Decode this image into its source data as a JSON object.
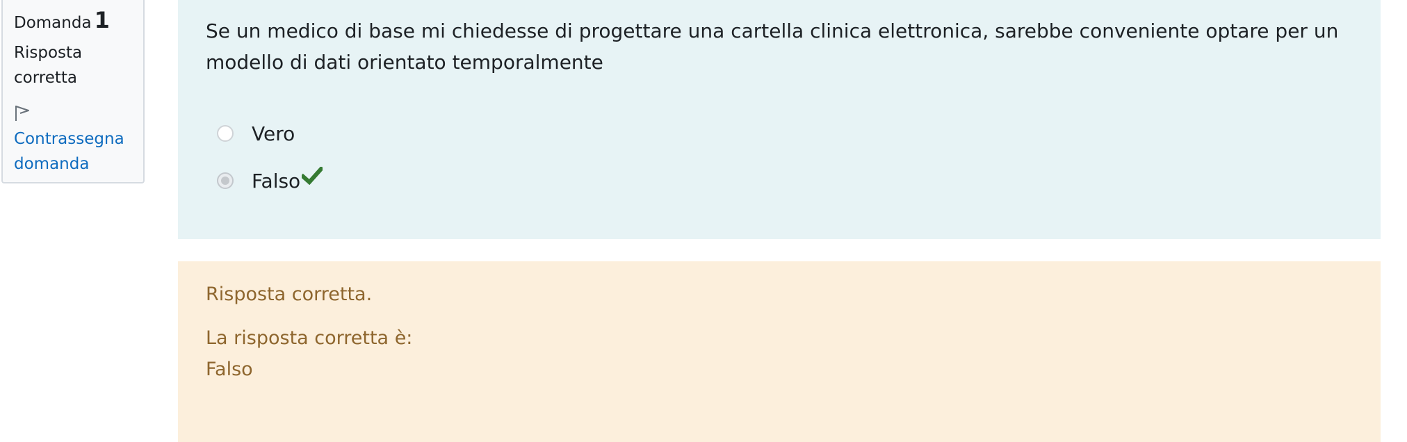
{
  "question_info": {
    "label": "Domanda",
    "number": "1",
    "state": "Risposta corretta",
    "flag_icon": "flag-icon",
    "flag_label": "Contrassegna domanda"
  },
  "question": {
    "text": "Se un medico di base mi chiedesse di progettare una cartella clinica elettronica, sarebbe conveniente optare per un modello di dati orientato temporalmente",
    "answers": [
      {
        "label": "Vero",
        "selected": false
      },
      {
        "label": "Falso",
        "selected": true,
        "correct_icon": "check-icon"
      }
    ]
  },
  "outcome": {
    "feedback": "Risposta corretta.",
    "right_answer_label": "La risposta corretta è:",
    "right_answer_value": "Falso"
  },
  "colors": {
    "formulation_bg": "#e7f3f5",
    "outcome_bg": "#fcefdc",
    "outcome_text": "#8e662e",
    "link": "#0f6cbf",
    "check": "#357a32"
  }
}
